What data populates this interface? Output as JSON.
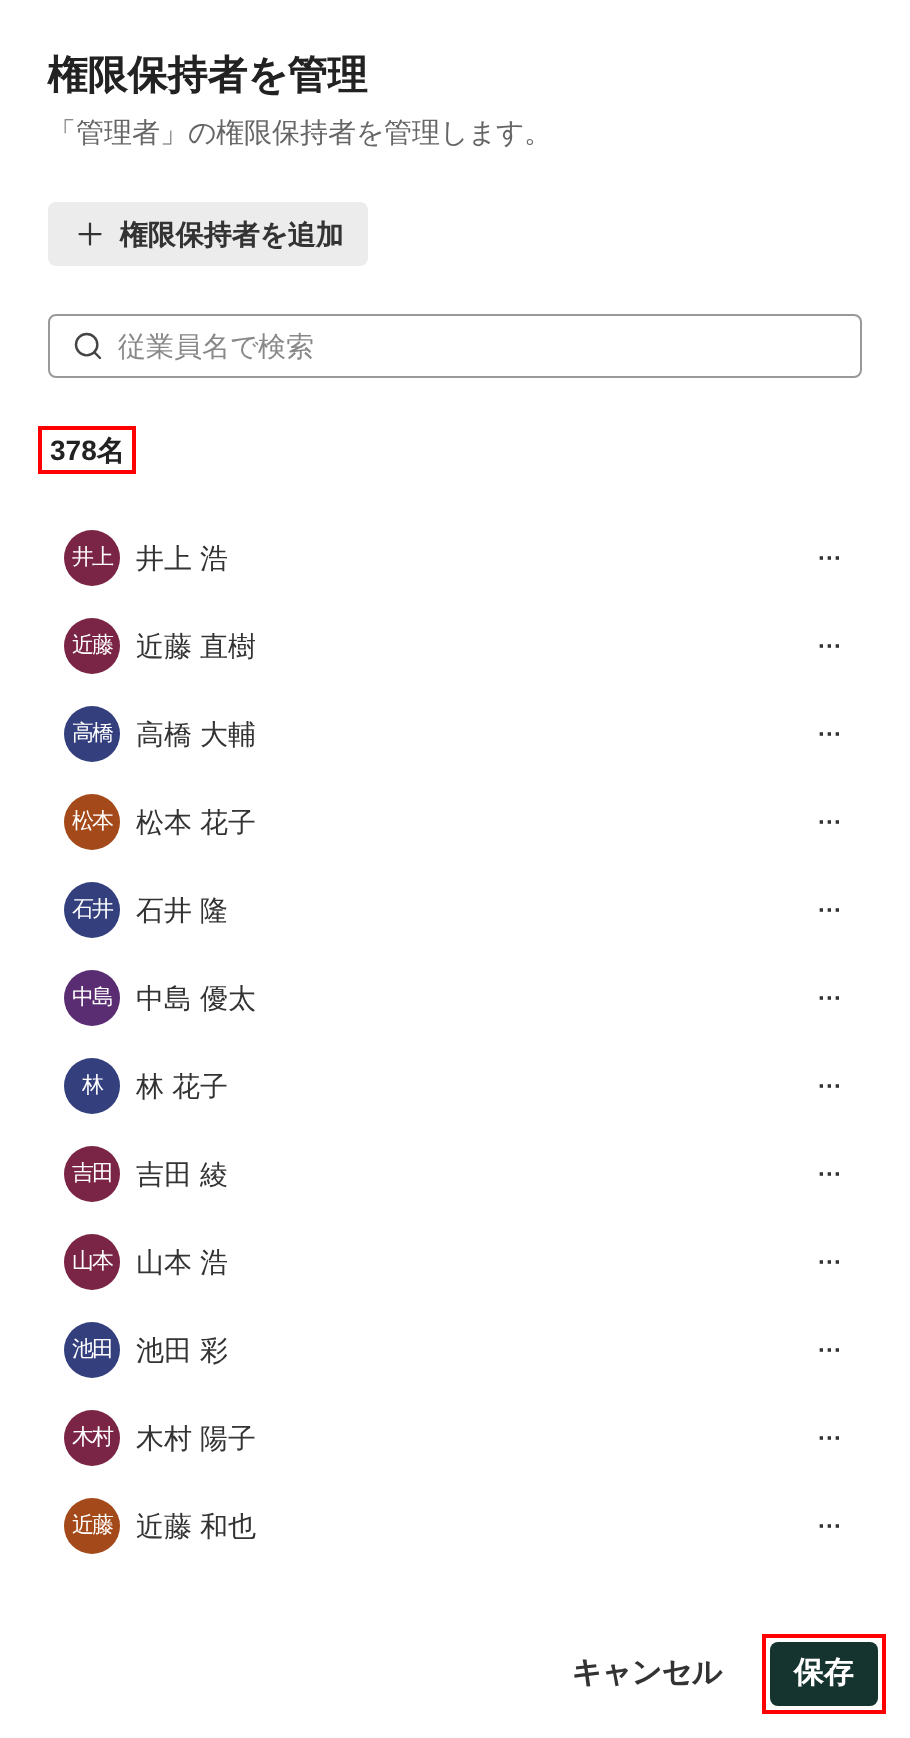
{
  "title": "権限保持者を管理",
  "subtitle": "「管理者」の権限保持者を管理します。",
  "add_button": {
    "label": "権限保持者を追加"
  },
  "search": {
    "placeholder": "従業員名で検索"
  },
  "count": {
    "text": "378名",
    "highlighted": true
  },
  "members": [
    {
      "initials": "井上",
      "name": "井上 浩",
      "color": "#7a2545"
    },
    {
      "initials": "近藤",
      "name": "近藤 直樹",
      "color": "#7a2545"
    },
    {
      "initials": "高橋",
      "name": "高橋 大輔",
      "color": "#343f7e"
    },
    {
      "initials": "松本",
      "name": "松本 花子",
      "color": "#a44a1a"
    },
    {
      "initials": "石井",
      "name": "石井 隆",
      "color": "#343f7e"
    },
    {
      "initials": "中島",
      "name": "中島 優太",
      "color": "#5a2d72"
    },
    {
      "initials": "林",
      "name": "林 花子",
      "color": "#343f7e"
    },
    {
      "initials": "吉田",
      "name": "吉田 綾",
      "color": "#7a2545"
    },
    {
      "initials": "山本",
      "name": "山本 浩",
      "color": "#7a2545"
    },
    {
      "initials": "池田",
      "name": "池田 彩",
      "color": "#343f7e"
    },
    {
      "initials": "木村",
      "name": "木村 陽子",
      "color": "#7a2545"
    },
    {
      "initials": "近藤",
      "name": "近藤 和也",
      "color": "#a44a1a"
    }
  ],
  "more_label": "···",
  "cancel_button": {
    "label": "キャンセル"
  },
  "save_button": {
    "label": "保存",
    "highlighted": true
  }
}
